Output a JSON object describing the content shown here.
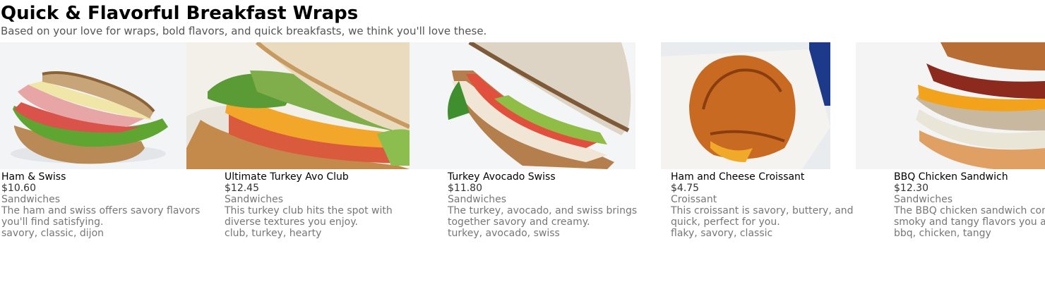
{
  "header": {
    "title": "Quick & Flavorful Breakfast Wraps",
    "subtitle": "Based on your love for wraps, bold flavors, and quick breakfasts, we think you'll love these."
  },
  "items": [
    {
      "name": "Ham & Swiss",
      "price": "$10.60",
      "category": "Sandwiches",
      "description": "The ham and swiss offers savory flavors you'll find satisfying.",
      "tags": "savory, classic, dijon",
      "image_icon": "ham-swiss-sandwich-photo"
    },
    {
      "name": "Ultimate Turkey Avo Club",
      "price": "$12.45",
      "category": "Sandwiches",
      "description": "This turkey club hits the spot with diverse textures you enjoy.",
      "tags": "club, turkey, hearty",
      "image_icon": "turkey-avo-club-photo"
    },
    {
      "name": "Turkey Avocado Swiss",
      "price": "$11.80",
      "category": "Sandwiches",
      "description": "The turkey, avocado, and swiss brings together savory and creamy.",
      "tags": "turkey, avocado, swiss",
      "image_icon": "turkey-avocado-swiss-photo"
    },
    {
      "name": "Ham and Cheese Croissant",
      "price": "$4.75",
      "category": "Croissant",
      "description": "This croissant is savory, buttery, and quick, perfect for you.",
      "tags": "flaky, savory, classic",
      "image_icon": "croissant-photo"
    },
    {
      "name": "BBQ Chicken Sandwich",
      "price": "$12.30",
      "category": "Sandwiches",
      "description": "The BBQ chicken sandwich combines smoky and tangy flavors you appreciate.",
      "tags": "bbq, chicken, tangy",
      "image_icon": "bbq-chicken-sandwich-photo"
    }
  ]
}
